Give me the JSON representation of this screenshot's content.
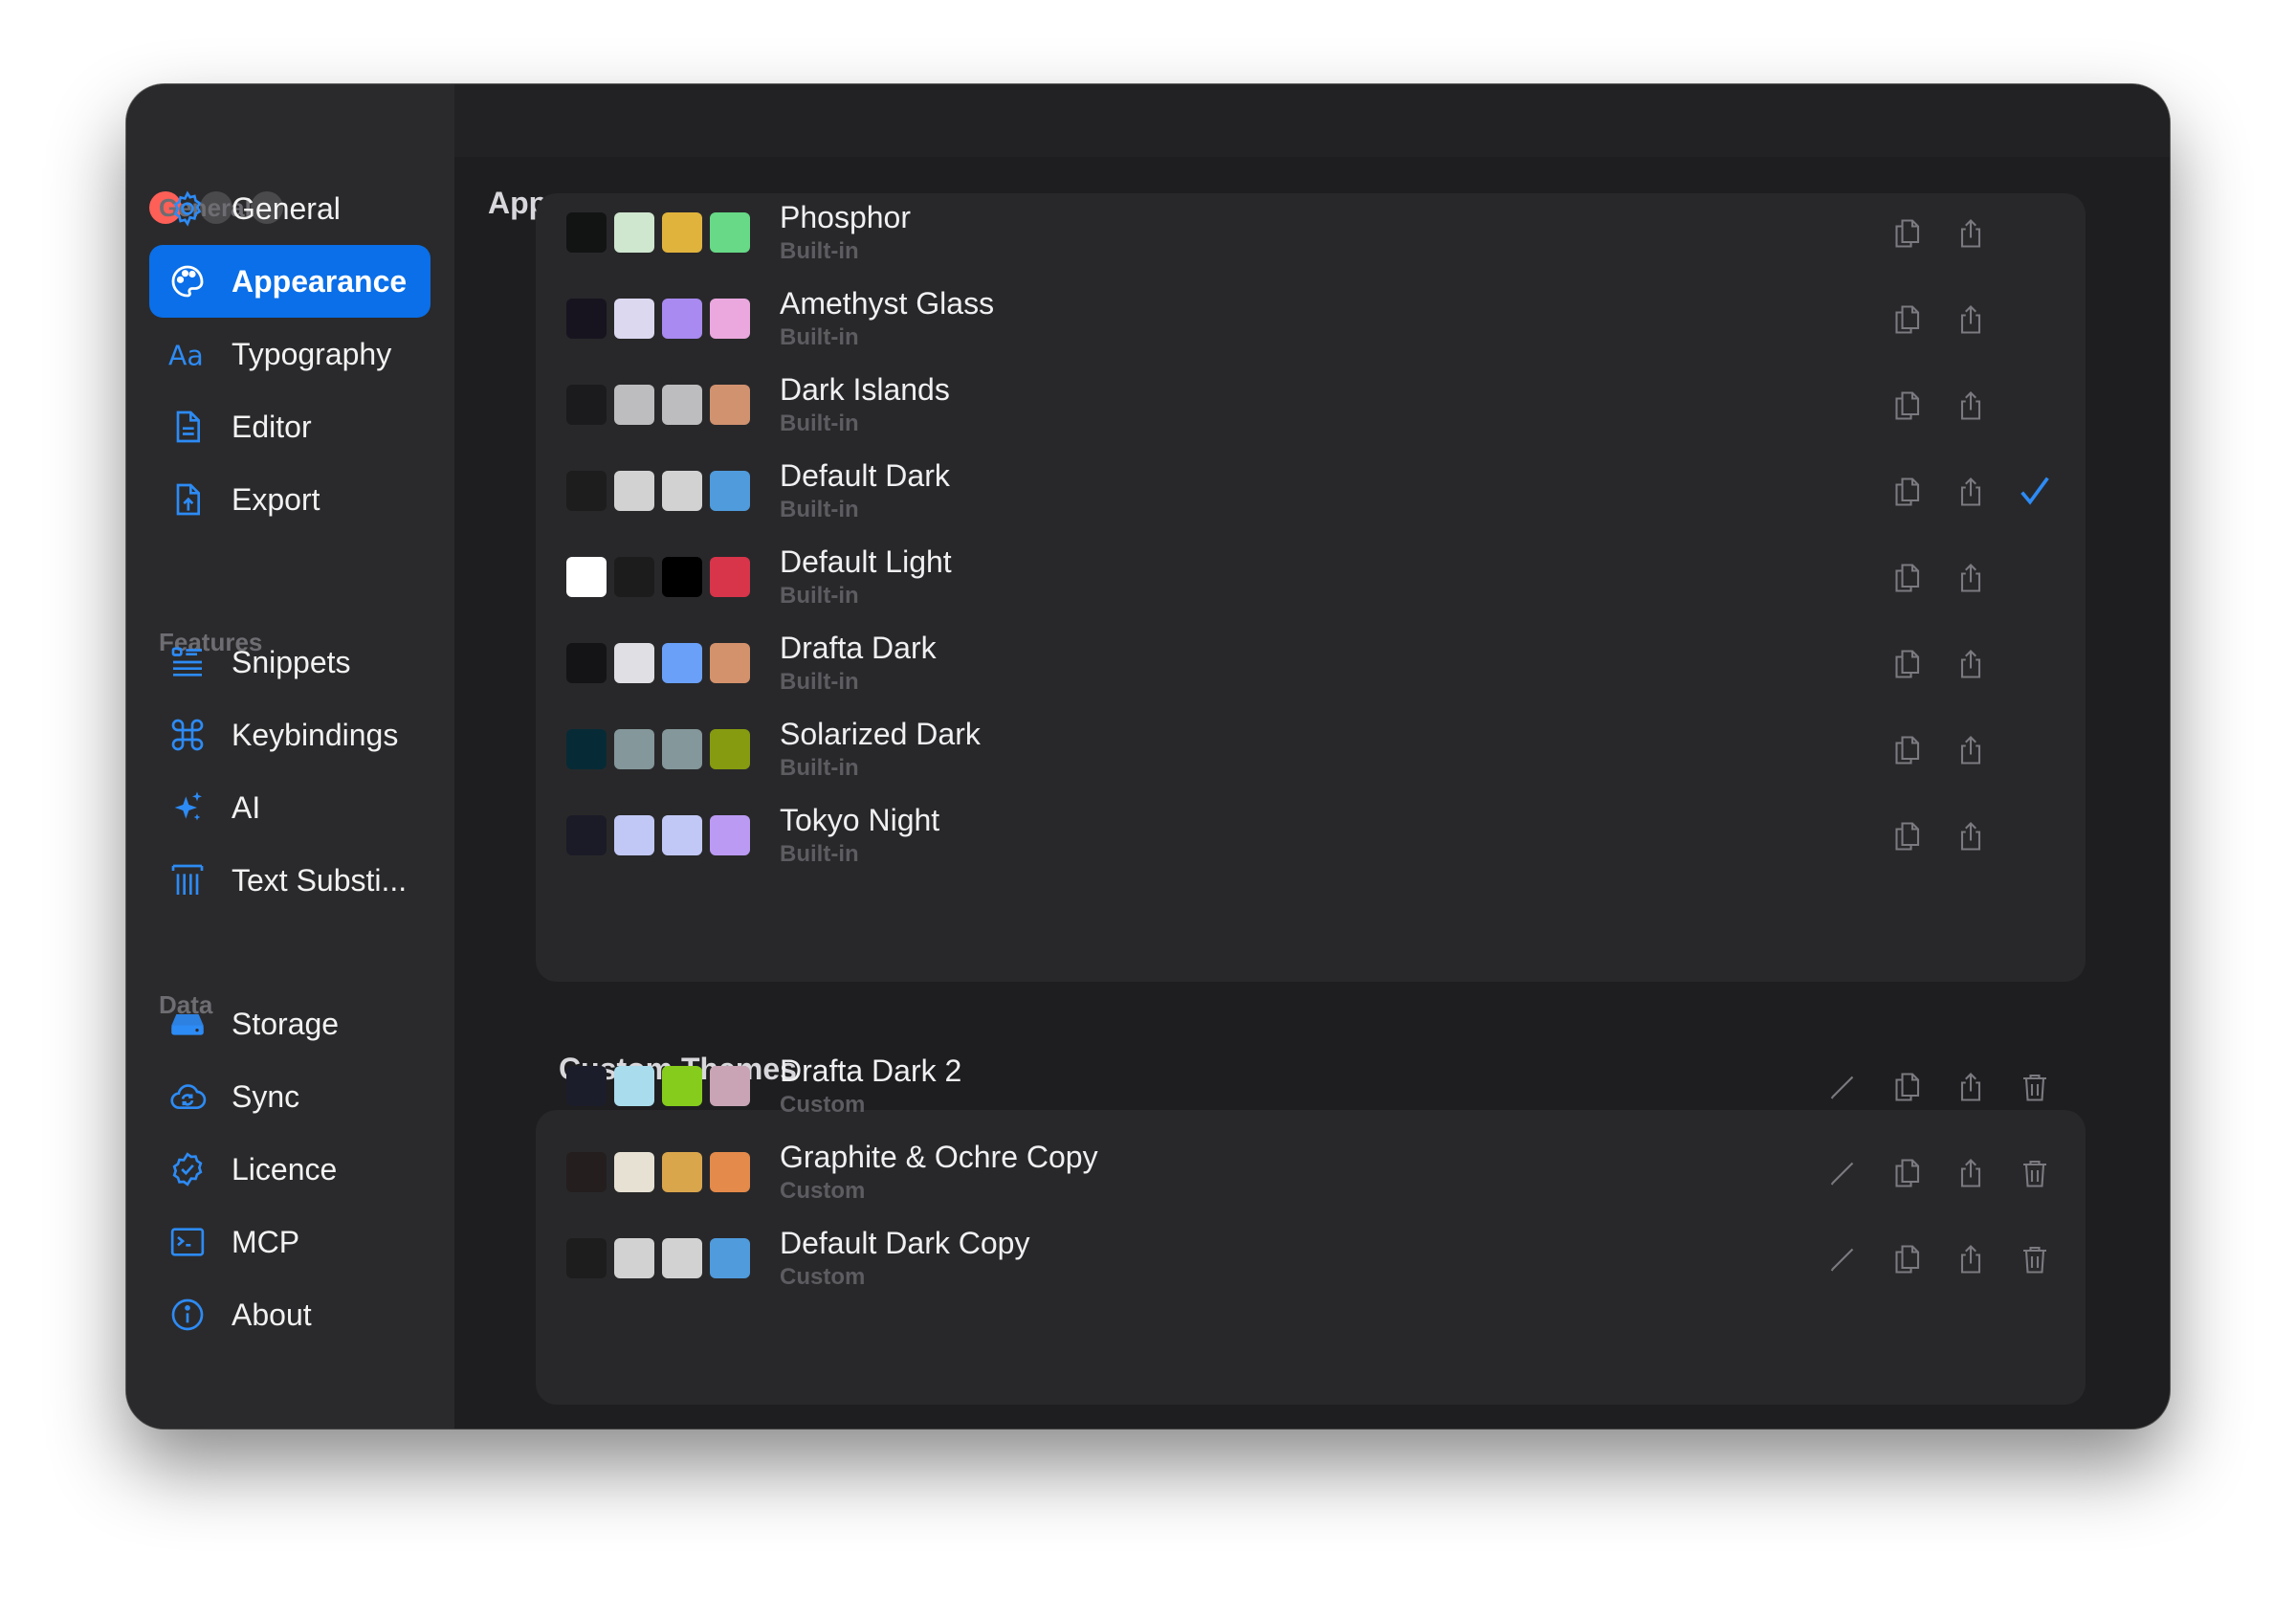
{
  "window": {
    "title": "Appearance"
  },
  "sidebar": {
    "sections": [
      {
        "label": "General",
        "items": [
          {
            "label": "General",
            "icon": "gear-icon"
          },
          {
            "label": "Appearance",
            "icon": "palette-icon",
            "active": true
          },
          {
            "label": "Typography",
            "icon": "typography-icon"
          },
          {
            "label": "Editor",
            "icon": "document-icon"
          },
          {
            "label": "Export",
            "icon": "export-document-icon"
          }
        ]
      },
      {
        "label": "Features",
        "items": [
          {
            "label": "Snippets",
            "icon": "list-icon"
          },
          {
            "label": "Keybindings",
            "icon": "command-key-icon"
          },
          {
            "label": "AI",
            "icon": "sparkles-icon"
          },
          {
            "label": "Text Substi...",
            "icon": "text-substitution-icon"
          }
        ]
      },
      {
        "label": "Data",
        "items": [
          {
            "label": "Storage",
            "icon": "drive-icon"
          },
          {
            "label": "Sync",
            "icon": "cloud-sync-icon"
          },
          {
            "label": "Licence",
            "icon": "seal-check-icon"
          },
          {
            "label": "MCP",
            "icon": "terminal-icon"
          },
          {
            "label": "About",
            "icon": "info-icon"
          }
        ]
      }
    ]
  },
  "builtin_themes": [
    {
      "name": "Phosphor",
      "type": "Built-in",
      "swatches": [
        "#121414",
        "#cfe6cf",
        "#e0b33c",
        "#67d987"
      ]
    },
    {
      "name": "Amethyst Glass",
      "type": "Built-in",
      "swatches": [
        "#17141f",
        "#dcd8f0",
        "#a88af0",
        "#eaa8de"
      ]
    },
    {
      "name": "Dark Islands",
      "type": "Built-in",
      "swatches": [
        "#1b1b1d",
        "#bdbdc0",
        "#bdbdc0",
        "#d19270"
      ]
    },
    {
      "name": "Default Dark",
      "type": "Built-in",
      "swatches": [
        "#1d1d1d",
        "#d2d2d2",
        "#d2d2d2",
        "#4f9bdc"
      ],
      "selected": true
    },
    {
      "name": "Default Light",
      "type": "Built-in",
      "swatches": [
        "#ffffff",
        "#1c1c1c",
        "#000000",
        "#d8344a"
      ]
    },
    {
      "name": "Drafta Dark",
      "type": "Built-in",
      "swatches": [
        "#141416",
        "#e0e0e4",
        "#6aa0f8",
        "#d4926c"
      ]
    },
    {
      "name": "Solarized Dark",
      "type": "Built-in",
      "swatches": [
        "#062b36",
        "#84979a",
        "#84979a",
        "#869b10"
      ]
    },
    {
      "name": "Tokyo Night",
      "type": "Built-in",
      "swatches": [
        "#1b1b27",
        "#c2c8f6",
        "#c2c8f6",
        "#bb9af4"
      ]
    }
  ],
  "custom_section": {
    "label": "Custom Themes"
  },
  "custom_themes": [
    {
      "name": "Drafta Dark 2",
      "type": "Custom",
      "swatches": [
        "#1b1d2b",
        "#a9dcec",
        "#86cc1c",
        "#c8a4b4"
      ]
    },
    {
      "name": "Graphite & Ochre Copy",
      "type": "Custom",
      "swatches": [
        "#241e1e",
        "#e6e1d3",
        "#daa64c",
        "#e48a4a"
      ]
    },
    {
      "name": "Default Dark Copy",
      "type": "Custom",
      "swatches": [
        "#1d1d1d",
        "#d2d2d2",
        "#d2d2d2",
        "#4f9bdc"
      ]
    }
  ],
  "colors": {
    "accent": "#0a6fe8",
    "close": "#fe5f57",
    "check": "#2d8bf5"
  }
}
